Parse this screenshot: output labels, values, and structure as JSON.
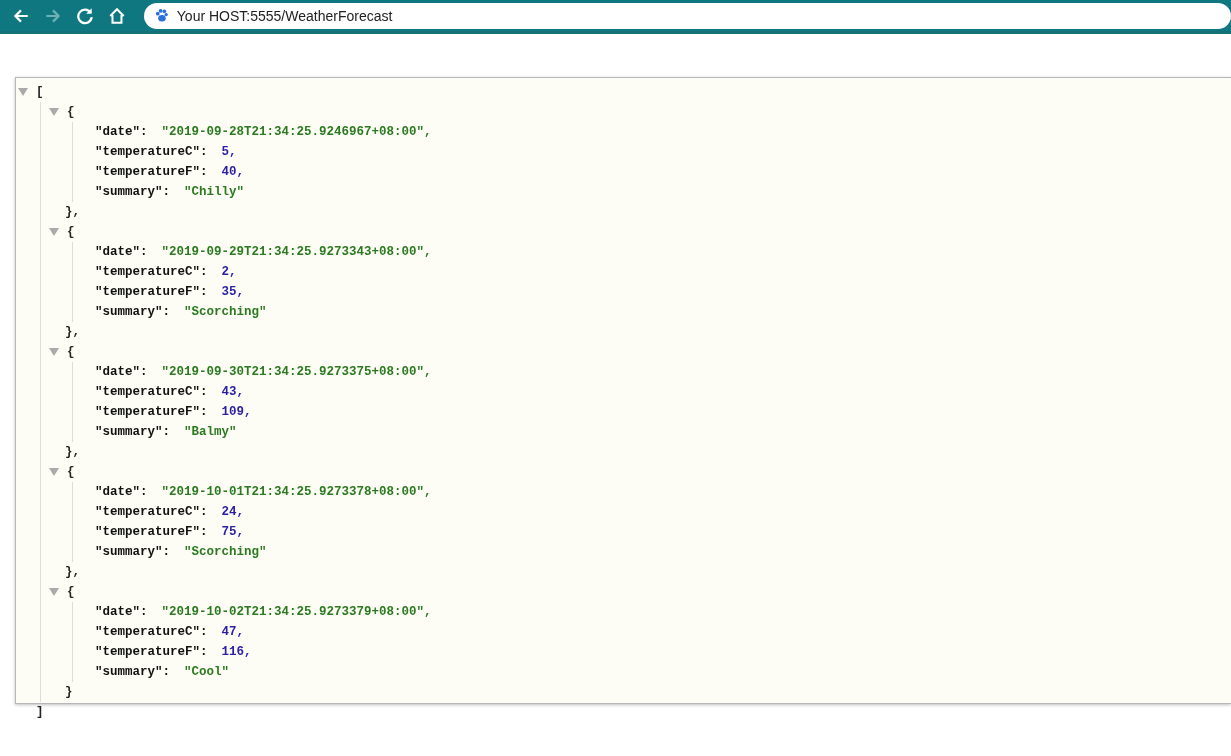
{
  "browser": {
    "address": "Your HOST:5555/WeatherForecast",
    "back_enabled": true,
    "forward_enabled": false
  },
  "viewer": {
    "open": "[",
    "close": "]",
    "expanded": true,
    "items": [
      {
        "open": "{",
        "close": "},",
        "expanded": true,
        "fields": [
          {
            "key": "\"date\":",
            "value": "\"2019-09-28T21:34:25.9246967+08:00\",",
            "kind": "string"
          },
          {
            "key": "\"temperatureC\":",
            "value": "5,",
            "kind": "number"
          },
          {
            "key": "\"temperatureF\":",
            "value": "40,",
            "kind": "number"
          },
          {
            "key": "\"summary\":",
            "value": "\"Chilly\"",
            "kind": "string"
          }
        ]
      },
      {
        "open": "{",
        "close": "},",
        "expanded": true,
        "fields": [
          {
            "key": "\"date\":",
            "value": "\"2019-09-29T21:34:25.9273343+08:00\",",
            "kind": "string"
          },
          {
            "key": "\"temperatureC\":",
            "value": "2,",
            "kind": "number"
          },
          {
            "key": "\"temperatureF\":",
            "value": "35,",
            "kind": "number"
          },
          {
            "key": "\"summary\":",
            "value": "\"Scorching\"",
            "kind": "string"
          }
        ]
      },
      {
        "open": "{",
        "close": "},",
        "expanded": true,
        "fields": [
          {
            "key": "\"date\":",
            "value": "\"2019-09-30T21:34:25.9273375+08:00\",",
            "kind": "string"
          },
          {
            "key": "\"temperatureC\":",
            "value": "43,",
            "kind": "number"
          },
          {
            "key": "\"temperatureF\":",
            "value": "109,",
            "kind": "number"
          },
          {
            "key": "\"summary\":",
            "value": "\"Balmy\"",
            "kind": "string"
          }
        ]
      },
      {
        "open": "{",
        "close": "},",
        "expanded": true,
        "fields": [
          {
            "key": "\"date\":",
            "value": "\"2019-10-01T21:34:25.9273378+08:00\",",
            "kind": "string"
          },
          {
            "key": "\"temperatureC\":",
            "value": "24,",
            "kind": "number"
          },
          {
            "key": "\"temperatureF\":",
            "value": "75,",
            "kind": "number"
          },
          {
            "key": "\"summary\":",
            "value": "\"Scorching\"",
            "kind": "string"
          }
        ]
      },
      {
        "open": "{",
        "close": "}",
        "expanded": true,
        "fields": [
          {
            "key": "\"date\":",
            "value": "\"2019-10-02T21:34:25.9273379+08:00\",",
            "kind": "string"
          },
          {
            "key": "\"temperatureC\":",
            "value": "47,",
            "kind": "number"
          },
          {
            "key": "\"temperatureF\":",
            "value": "116,",
            "kind": "number"
          },
          {
            "key": "\"summary\":",
            "value": "\"Cool\"",
            "kind": "string"
          }
        ]
      }
    ]
  }
}
